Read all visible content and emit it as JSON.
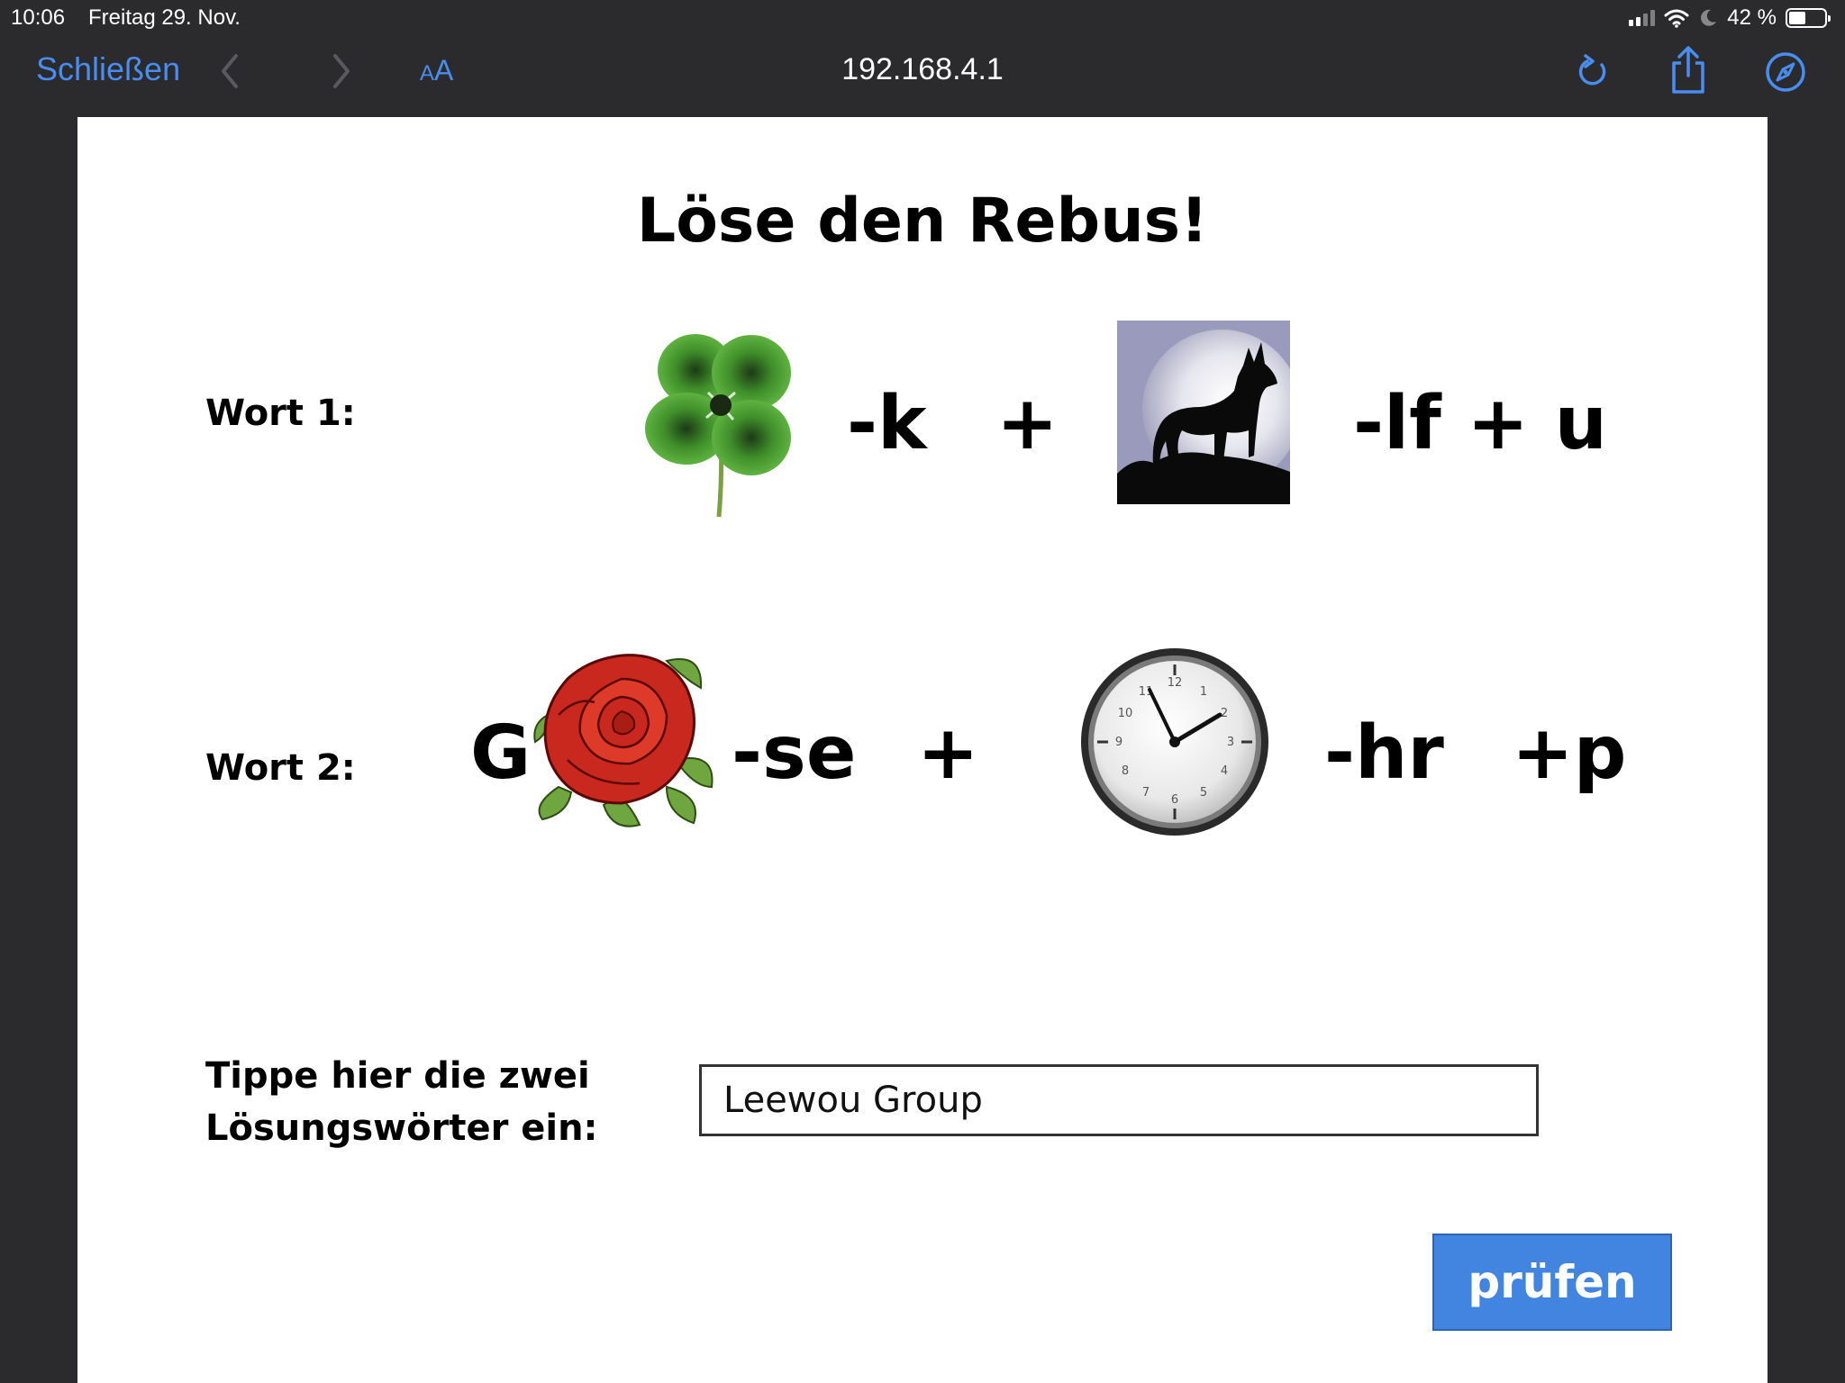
{
  "status_bar": {
    "time": "10:06",
    "date": "Freitag 29. Nov.",
    "battery": "42 %"
  },
  "browser": {
    "close_label": "Schließen",
    "text_size_label_small": "A",
    "text_size_label_large": "A",
    "url": "192.168.4.1",
    "accent_color": "#4a8df0"
  },
  "page": {
    "title": "Löse den Rebus!",
    "word1": {
      "label": "Wort 1:",
      "pic1_icon": "four-leaf-clover-icon",
      "minus1": "-k",
      "plus": "+",
      "pic2_icon": "howling-wolf-icon",
      "suffix": "-lf + u"
    },
    "word2": {
      "label": "Wort 2:",
      "prefix": "G",
      "pic1_icon": "rose-icon",
      "minus1": "-se",
      "plus": "+",
      "pic2_icon": "wall-clock-icon",
      "minus2": "-hr",
      "suffix": "+p"
    },
    "answer": {
      "label_line1": "Tippe hier die zwei",
      "label_line2": "Lösungswörter ein:",
      "value": "Leewou Group"
    },
    "check_button_label": "prüfen",
    "button_color": "#4285e0"
  }
}
